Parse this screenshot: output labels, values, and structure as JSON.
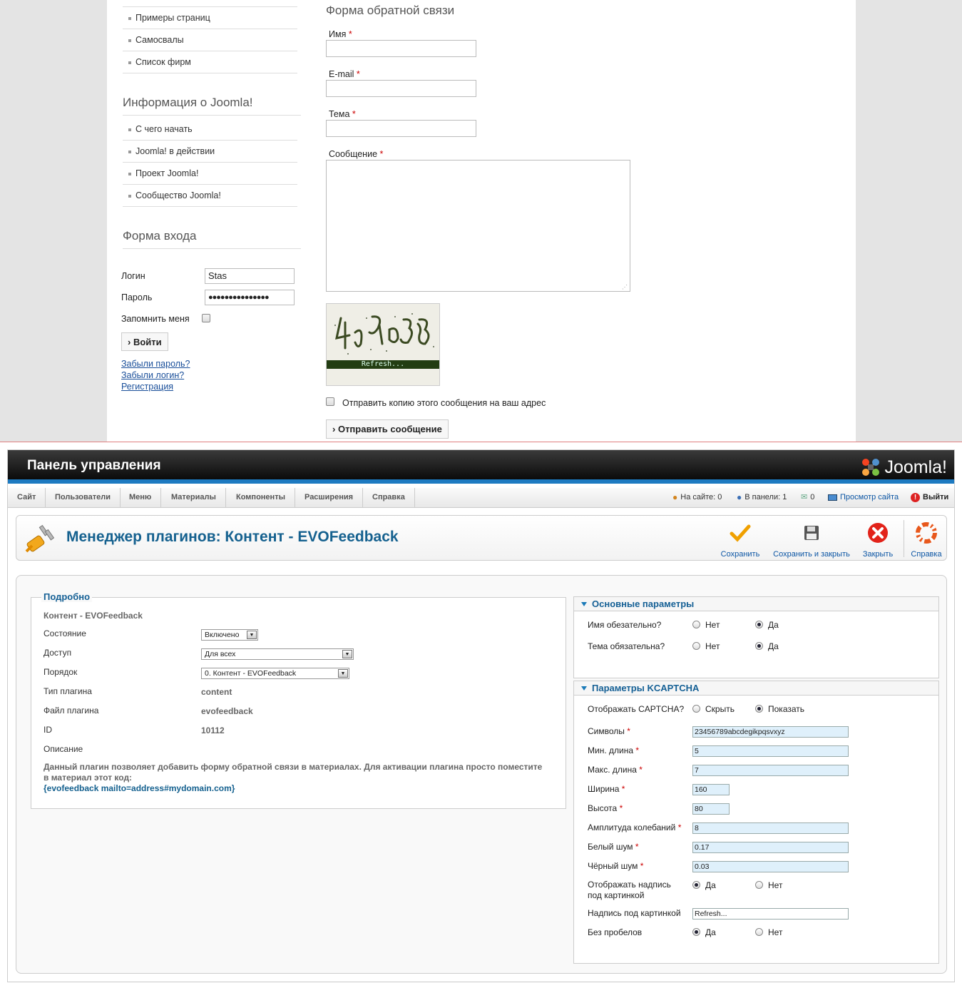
{
  "site": {
    "menu_top": [
      "Примеры страниц",
      "Самосвалы",
      "Список фирм"
    ],
    "info_heading": "Информация о Joomla!",
    "info_items": [
      "С чего начать",
      "Joomla! в действии",
      "Проект Joomla!",
      "Сообщество Joomla!"
    ],
    "login_heading": "Форма входа",
    "login_label": "Логин",
    "login_value": "Stas",
    "password_label": "Пароль",
    "password_value": "●●●●●●●●●●●●●●●",
    "remember_label": "Запомнить меня",
    "login_button": "Войти",
    "forgot_password": "Забыли пароль?",
    "forgot_login": "Забыли логин?",
    "register": "Регистрация",
    "feedback_title": "Форма обратной связи",
    "name_label": "Имя",
    "email_label": "E-mail",
    "subject_label": "Тема",
    "message_label": "Сообщение",
    "required_mark": "*",
    "captcha_refresh": "Refresh...",
    "copy_label": "Отправить копию этого сообщения на ваш адрес",
    "send_button": "Отправить сообщение"
  },
  "admin": {
    "title": "Панель управления",
    "logo_text": "Joomla!",
    "nav": [
      "Сайт",
      "Пользователи",
      "Меню",
      "Материалы",
      "Компоненты",
      "Расширения",
      "Справка"
    ],
    "status": {
      "on_site": "На сайте: 0",
      "in_panel": "В панели: 1",
      "messages": "0",
      "view_site": "Просмотр сайта",
      "logout": "Выйти"
    },
    "heading": "Менеджер плагинов: Контент - EVOFeedback",
    "toolbar": {
      "save": "Сохранить",
      "save_close": "Сохранить и закрыть",
      "close": "Закрыть",
      "help": "Справка"
    },
    "details": {
      "legend": "Подробно",
      "name": "Контент - EVOFeedback",
      "state_label": "Состояние",
      "state_value": "Включено",
      "access_label": "Доступ",
      "access_value": "Для всех",
      "order_label": "Порядок",
      "order_value": "0. Контент - EVOFeedback",
      "type_label": "Тип плагина",
      "type_value": "content",
      "file_label": "Файл плагина",
      "file_value": "evofeedback",
      "id_label": "ID",
      "id_value": "10112",
      "desc_label": "Описание",
      "desc_text": "Данный плагин позволяет добавить форму обратной связи в материалах. Для активации плагина просто поместите в материал этот код:",
      "desc_code": "{evofeedback mailto=address#mydomain.com}"
    },
    "basic": {
      "heading": "Основные параметры",
      "name_required": "Имя обезательно?",
      "subject_required": "Тема обязательна?",
      "no": "Нет",
      "yes": "Да"
    },
    "kcaptcha": {
      "heading": "Параметры KCAPTCHA",
      "show_label": "Отображать CAPTCHA?",
      "hide": "Скрыть",
      "show": "Показать",
      "symbols_label": "Символы",
      "symbols_value": "23456789abcdegikpqsvxyz",
      "min_label": "Мин. длина",
      "min_value": "5",
      "max_label": "Макс. длина",
      "max_value": "7",
      "width_label": "Ширина",
      "width_value": "160",
      "height_label": "Высота",
      "height_value": "80",
      "amp_label": "Амплитуда колебаний",
      "amp_value": "8",
      "white_label": "Белый шум",
      "white_value": "0.17",
      "black_label": "Чёрный шум",
      "black_value": "0.03",
      "caption_show_label_1": "Отображать надпись",
      "caption_show_label_2": "под картинкой",
      "caption_label": "Надпись под картинкой",
      "caption_value": "Refresh...",
      "nospaces_label": "Без пробелов",
      "yes": "Да",
      "no": "Нет"
    }
  },
  "colors": {
    "accent_blue": "#15618f",
    "header_stripe": "#1d7ac1",
    "link": "#1a4f9a",
    "required": "#cc0000"
  }
}
